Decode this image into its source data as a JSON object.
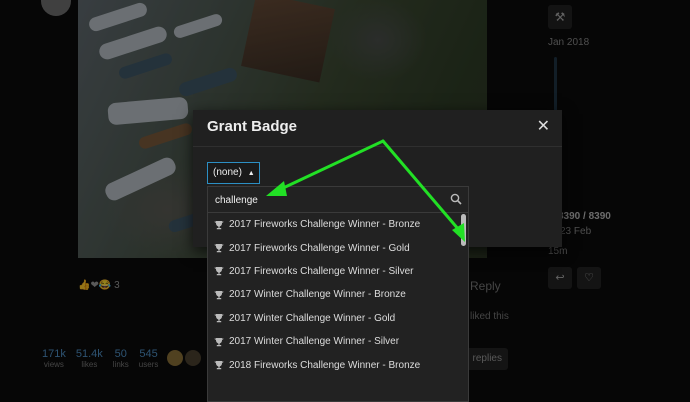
{
  "background": {
    "timeline": {
      "date_start": "Jan 2018",
      "post_count": "8390 / 8390",
      "date_end": "23 Feb",
      "ago": "15m"
    },
    "post": {
      "reaction_count": "3",
      "reply_label": "Reply",
      "liked_text": "liked this"
    },
    "stats": [
      {
        "number": "171k",
        "label": "views"
      },
      {
        "number": "51.4k",
        "label": "likes"
      },
      {
        "number": "50",
        "label": "links"
      },
      {
        "number": "545",
        "label": "users"
      }
    ],
    "replies_button": "replies"
  },
  "modal": {
    "title": "Grant Badge",
    "close_icon": "close-icon"
  },
  "badge_select": {
    "selected": "(none)",
    "filter_value": "challenge",
    "options": [
      "2017 Fireworks Challenge Winner - Bronze",
      "2017 Fireworks Challenge Winner - Gold",
      "2017 Fireworks Challenge Winner - Silver",
      "2017 Winter Challenge Winner - Bronze",
      "2017 Winter Challenge Winner - Gold",
      "2017 Winter Challenge Winner - Silver",
      "2018 Fireworks Challenge Winner - Bronze"
    ],
    "option_icon": "trophy-icon"
  },
  "colors": {
    "accent": "#2c8fc4",
    "annotation_arrow": "#22e025",
    "modal_bg": "#202020",
    "page_bg": "#0b0b0b"
  }
}
